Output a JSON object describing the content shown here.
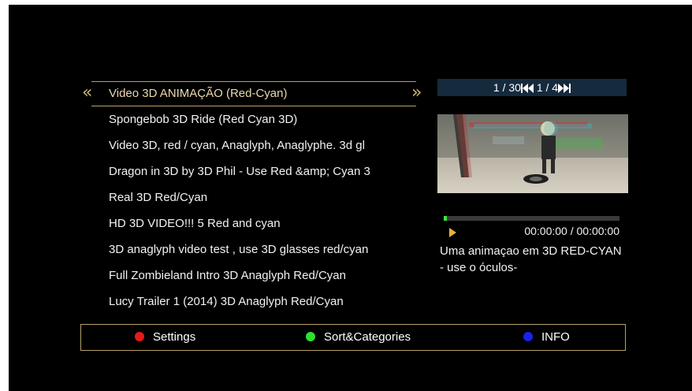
{
  "list": {
    "items": [
      "Video 3D ANIMAÇÃO (Red-Cyan)",
      "Spongebob 3D Ride (Red Cyan 3D)",
      "Video 3D, red / cyan, Anaglyph, Anaglyphe. 3d gl",
      "Dragon in 3D by 3D Phil - Use Red &amp; Cyan 3",
      "Real 3D Red/Cyan",
      "HD 3D VIDEO!!! 5 Red and cyan",
      "3D anaglyph video test , use 3D glasses red/cyan",
      "Full Zombieland Intro 3D Anaglyph Red/Cyan",
      "Lucy Trailer 1 (2014) 3D Anaglyph Red/Cyan"
    ]
  },
  "pager": {
    "page": "1 / 30",
    "subpage": "1 / 4"
  },
  "player": {
    "progress": 0.02,
    "time": "00:00:00 / 00:00:00",
    "description": "Uma animaçao em 3D RED-CYAN - use o óculos-"
  },
  "footer": {
    "settings": "Settings",
    "sort": "Sort&Categories",
    "info": "INFO"
  },
  "colors": {
    "red": "#e51b1b",
    "green": "#2ee02b",
    "blue": "#1a22e8",
    "gold": "#b8a16a"
  }
}
